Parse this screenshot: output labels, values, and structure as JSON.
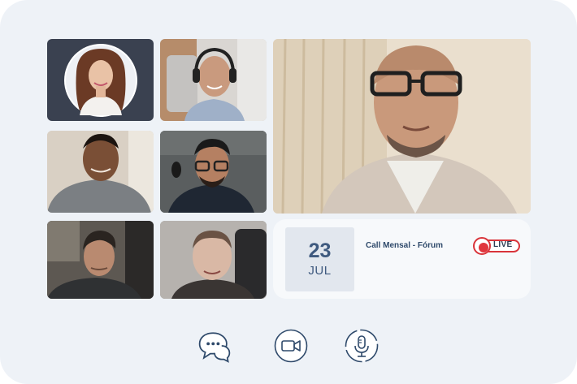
{
  "participants": [
    {
      "name": "participant-1",
      "kind": "avatar-circle"
    },
    {
      "name": "participant-2"
    },
    {
      "name": "participant-3"
    },
    {
      "name": "participant-4"
    },
    {
      "name": "participant-5"
    },
    {
      "name": "participant-6"
    },
    {
      "name": "participant-7"
    }
  ],
  "event": {
    "day": "23",
    "month": "JUL",
    "title": "Call Mensal - Fórum",
    "live_label": "LIVE"
  },
  "controls": [
    {
      "icon": "chat-icon"
    },
    {
      "icon": "video-camera-icon"
    },
    {
      "icon": "microphone-icon"
    }
  ],
  "colors": {
    "background": "#eef2f7",
    "accent": "#3f5a7f",
    "live_red": "#d9343a"
  }
}
